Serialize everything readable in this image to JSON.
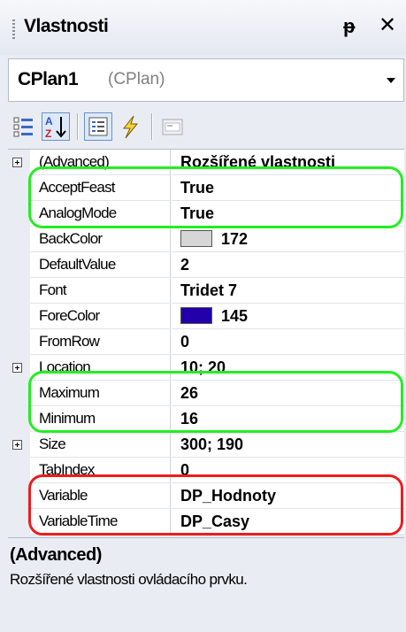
{
  "title": "Vlastnosti",
  "pin_glyph": "ᵽ",
  "close_glyph": "✕",
  "selector": {
    "object_name": "CPlan1",
    "object_type": "(CPlan)"
  },
  "toolbar": {
    "buttons": [
      {
        "name": "categorized",
        "icon": "categorized-icon",
        "active": false
      },
      {
        "name": "alphabetical",
        "icon": "sort-az-icon",
        "active": true
      },
      {
        "name": "properties",
        "icon": "properties-icon",
        "active": true
      },
      {
        "name": "events",
        "icon": "lightning-icon",
        "active": false
      },
      {
        "name": "property-pages",
        "icon": "property-pages-icon",
        "active": false
      }
    ]
  },
  "properties": [
    {
      "name": "(Advanced)",
      "value": "Rozšířené vlastnosti",
      "expandable": true
    },
    {
      "name": "AcceptFeast",
      "value": "True"
    },
    {
      "name": "AnalogMode",
      "value": "True"
    },
    {
      "name": "BackColor",
      "value": "172",
      "swatch": "#d6d6d6"
    },
    {
      "name": "DefaultValue",
      "value": "2"
    },
    {
      "name": "Font",
      "value": "Tridet 7"
    },
    {
      "name": "ForeColor",
      "value": "145",
      "swatch": "#2200aa"
    },
    {
      "name": "FromRow",
      "value": "0"
    },
    {
      "name": "Location",
      "value": "10; 20",
      "expandable": true
    },
    {
      "name": "Maximum",
      "value": "26"
    },
    {
      "name": "Minimum",
      "value": "16"
    },
    {
      "name": "Size",
      "value": "300; 190",
      "expandable": true
    },
    {
      "name": "TabIndex",
      "value": "0"
    },
    {
      "name": "Variable",
      "value": "DP_Hodnoty"
    },
    {
      "name": "VariableTime",
      "value": "DP_Casy"
    }
  ],
  "description": {
    "title": "(Advanced)",
    "text": "Rozšířené vlastnosti ovládacího prvku."
  },
  "colors": {
    "highlight_green": "#22ee22",
    "highlight_red": "#ee1c1c",
    "panel_bg": "#e9ecf3"
  }
}
